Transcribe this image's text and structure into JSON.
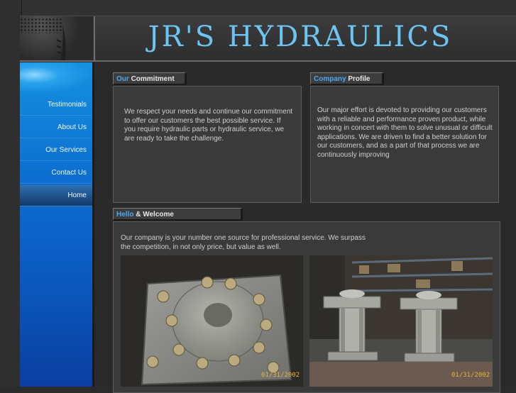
{
  "header": {
    "title": "JR'S HYDRAULICS"
  },
  "nav": {
    "items": [
      {
        "label": "Testimonials"
      },
      {
        "label": "About Us"
      },
      {
        "label": "Our Services"
      },
      {
        "label": "Contact Us"
      },
      {
        "label": "Home",
        "active": true
      }
    ]
  },
  "commitment": {
    "title_highlight": "Our",
    "title_rest": "Commitment",
    "text": "We respect your needs and continue our commitment to offer our customers the best possible service. If you require hydraulic parts or hydraulic service, we are ready to take the challenge."
  },
  "profile": {
    "title_highlight": "Company",
    "title_rest": "Profile",
    "text": "Our major effort is devoted to providing our customers with a reliable and performance proven product, while working in concert with them to solve unusual or difficult applications. We are driven to find a better solution for our customers, and as a part of that process we are continuously improving"
  },
  "welcome": {
    "title_highlight": "Hello",
    "title_rest": "& Welcome",
    "text": "Our company is your number one source for professional service. We surpass the competition, in not only price, but value as well."
  },
  "photos": [
    {
      "date_stamp": "01/31/2002"
    },
    {
      "date_stamp": "01/31/2002"
    }
  ],
  "colors": {
    "accent_blue": "#4aa8f0",
    "title_blue": "#6cc4f2",
    "sidebar_blue": "#0d6fd0"
  }
}
